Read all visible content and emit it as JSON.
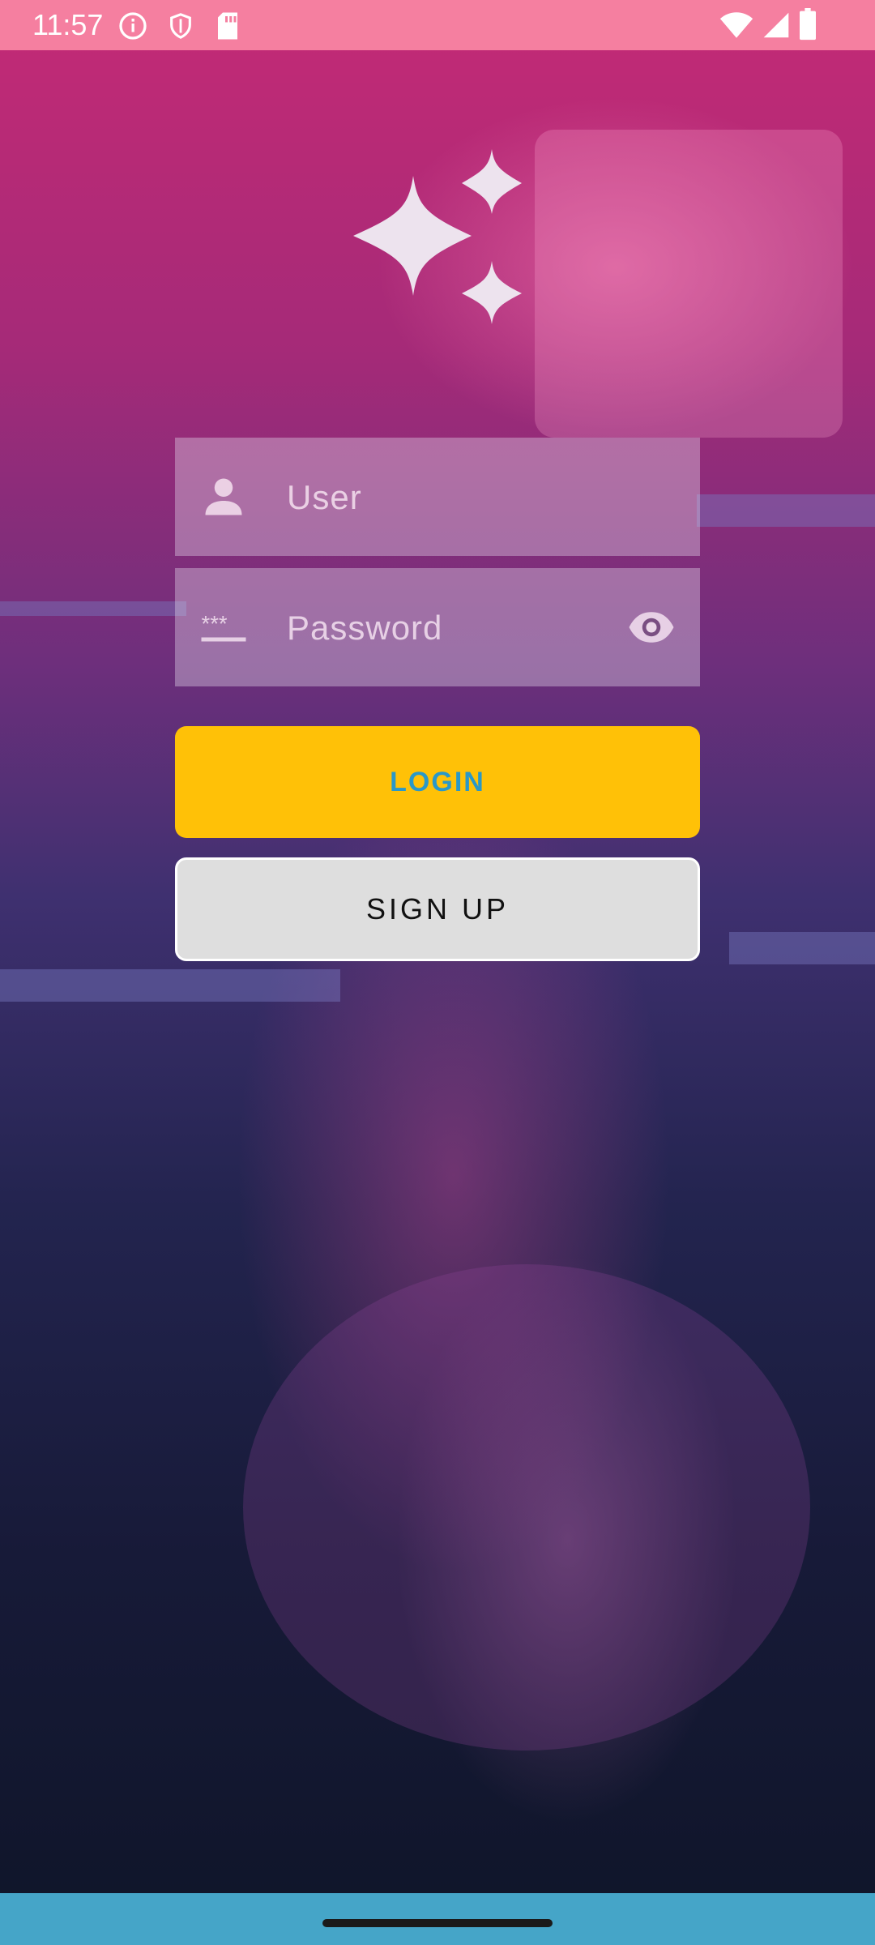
{
  "status_bar": {
    "time": "11:57",
    "left_icons": [
      "info-icon",
      "shield-icon",
      "sd-card-icon"
    ],
    "right_icons": [
      "wifi-icon",
      "cellular-signal-icon",
      "battery-icon"
    ],
    "background_color": "#f57fa0"
  },
  "logo": {
    "icon": "sparkle-stars-icon"
  },
  "login_form": {
    "user": {
      "placeholder": "User",
      "value": "",
      "icon": "person-icon"
    },
    "password": {
      "placeholder": "Password",
      "value": "",
      "icon": "password-dots-icon",
      "toggle_icon": "eye-icon"
    },
    "login_label": "LOGIN",
    "signup_label": "SIGN UP"
  },
  "colors": {
    "login_button": "#ffc107",
    "login_text": "#2a98c8",
    "signup_button": "#dedede",
    "nav_bar": "#45a5c8"
  },
  "nav_bar": {
    "handle": "gesture-handle"
  }
}
